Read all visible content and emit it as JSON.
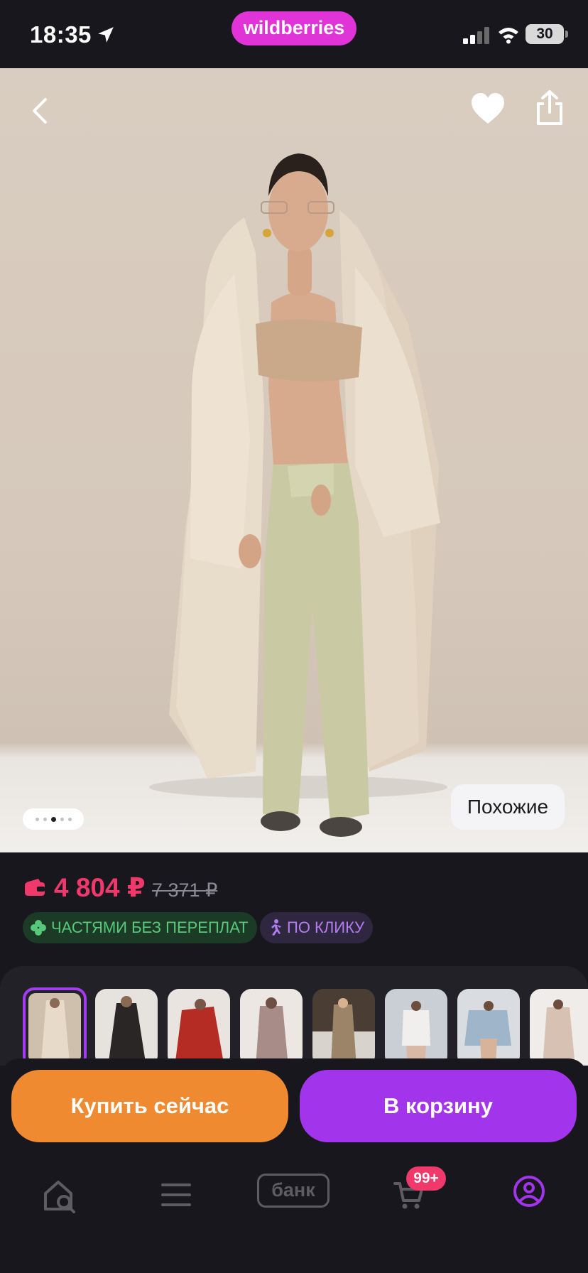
{
  "status_bar": {
    "time": "18:35",
    "brand": "wildberries",
    "battery": "30",
    "location_icon": "location-arrow-icon",
    "signal_icon": "cellular-signal-icon",
    "wifi_icon": "wifi-icon"
  },
  "photo": {
    "back_icon": "chevron-left-icon",
    "favorite_icon": "heart-icon",
    "share_icon": "share-icon",
    "similar_label": "Похожие",
    "carousel_dots": 5,
    "carousel_active_index": 2
  },
  "price": {
    "current": "4 804 ₽",
    "old": "7 371 ₽",
    "wallet_icon": "wallet-icon"
  },
  "badges": {
    "parts_label": "ЧАСТЯМИ БЕЗ ПЕРЕПЛАТ",
    "parts_icon": "clover-icon",
    "click_label": "ПО КЛИКУ",
    "click_icon": "running-man-icon"
  },
  "gallery": {
    "selected_index": 0,
    "thumbnails": [
      {
        "name": "thumb-beige-robe",
        "color": "#cfc0ad"
      },
      {
        "name": "thumb-black-robe",
        "color": "#3a3434"
      },
      {
        "name": "thumb-red-robe",
        "color": "#b52c25"
      },
      {
        "name": "thumb-mauve-robe",
        "color": "#a88c88"
      },
      {
        "name": "thumb-tan-robe",
        "color": "#9c8468"
      },
      {
        "name": "thumb-white-set",
        "color": "#e7e4e3"
      },
      {
        "name": "thumb-blue-set",
        "color": "#9fb5c9"
      },
      {
        "name": "thumb-nude-robe",
        "color": "#d6c1b3"
      }
    ]
  },
  "actions": {
    "buy_now": "Купить сейчас",
    "add_to_cart": "В корзину"
  },
  "tabbar": {
    "home_icon": "home-search-icon",
    "catalog_icon": "menu-icon",
    "bank_label": "банк",
    "cart_icon": "cart-icon",
    "cart_count": "99+",
    "profile_icon": "profile-icon"
  },
  "colors": {
    "background": "#18171d",
    "price": "#f0386b",
    "buy_now": "#f08a30",
    "add_to_cart": "#a235ec",
    "brand": "#e033d8"
  }
}
